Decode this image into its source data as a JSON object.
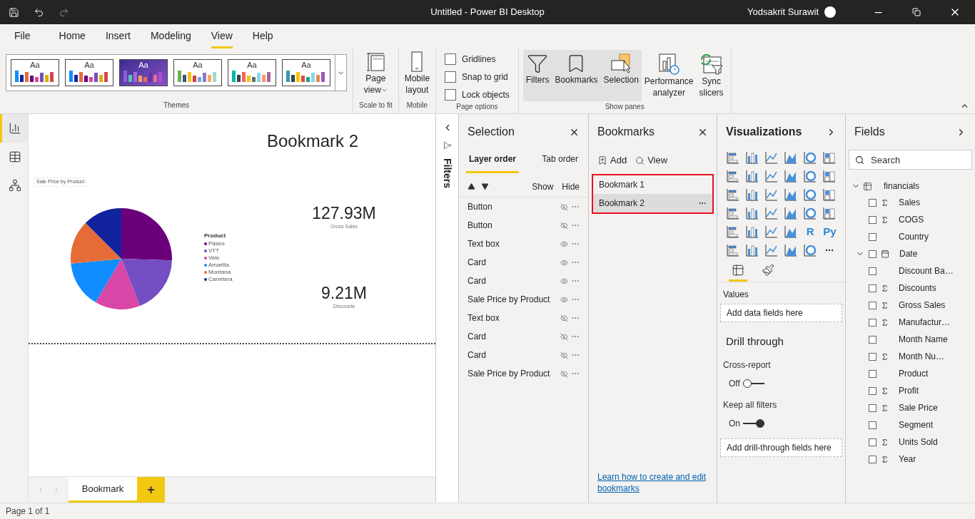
{
  "window": {
    "title": "Untitled - Power BI Desktop",
    "user": "Yodsakrit Surawit"
  },
  "menu_tabs": [
    {
      "label": "File",
      "selected": false
    },
    {
      "label": "Home",
      "selected": false
    },
    {
      "label": "Insert",
      "selected": false
    },
    {
      "label": "Modeling",
      "selected": false
    },
    {
      "label": "View",
      "selected": true
    },
    {
      "label": "Help",
      "selected": false
    }
  ],
  "ribbon": {
    "themes": {
      "items": [
        {
          "label": "Aa",
          "selected": false
        },
        {
          "label": "Aa",
          "selected": false
        },
        {
          "label": "Aa",
          "selected": true
        },
        {
          "label": "Aa",
          "selected": false
        },
        {
          "label": "Aa",
          "selected": false
        },
        {
          "label": "Aa",
          "selected": false
        }
      ],
      "group": "Themes"
    },
    "scale": {
      "label_1": "Page",
      "label_2": "view",
      "group": "Scale to fit"
    },
    "mobile": {
      "label_1": "Mobile",
      "label_2": "layout",
      "group": "Mobile"
    },
    "page_options": {
      "items": [
        {
          "label": "Gridlines",
          "checked": false
        },
        {
          "label": "Snap to grid",
          "checked": false
        },
        {
          "label": "Lock objects",
          "checked": false
        }
      ],
      "group": "Page options"
    },
    "show_panes": {
      "items": [
        {
          "kind": "filters",
          "lines": [
            "Filters"
          ],
          "on": true
        },
        {
          "kind": "bookmarks",
          "lines": [
            "Bookmarks"
          ],
          "on": true
        },
        {
          "kind": "selection",
          "lines": [
            "Selection"
          ],
          "on": true
        },
        {
          "kind": "performance",
          "lines": [
            "Performance",
            "analyzer"
          ],
          "on": false
        },
        {
          "kind": "sync",
          "lines": [
            "Sync",
            "slicers"
          ],
          "on": false
        }
      ],
      "group": "Show panes"
    }
  },
  "left_nav": [
    {
      "kind": "report",
      "selected": true
    },
    {
      "kind": "data",
      "selected": false
    },
    {
      "kind": "model",
      "selected": false
    }
  ],
  "canvas": {
    "title": "Bookmark 2",
    "chart": {
      "title": "Sale Price by Product",
      "legend_title": "Product",
      "legend": [
        {
          "name": "Paseo",
          "color": "#6b007b"
        },
        {
          "name": "VTT",
          "color": "#744ec2"
        },
        {
          "name": "Velo",
          "color": "#d846a8"
        },
        {
          "name": "Amarilla",
          "color": "#118dff"
        },
        {
          "name": "Montana",
          "color": "#e66c37"
        },
        {
          "name": "Carretera",
          "color": "#12239e"
        }
      ]
    },
    "cards": [
      {
        "value": "127.93M",
        "label": "Gross Sales"
      },
      {
        "value": "9.21M",
        "label": "Discounts"
      }
    ],
    "page_tabs": [
      {
        "label": "Bookmark",
        "selected": true
      }
    ],
    "add_page": "+"
  },
  "filters_strip": {
    "label": "Filters"
  },
  "selection": {
    "title": "Selection",
    "tabs": [
      {
        "label": "Layer order",
        "selected": true
      },
      {
        "label": "Tab order",
        "selected": false
      }
    ],
    "show": "Show",
    "hide": "Hide",
    "items": [
      {
        "name": "Button",
        "visible": false
      },
      {
        "name": "Button",
        "visible": false
      },
      {
        "name": "Text box",
        "visible": true
      },
      {
        "name": "Card",
        "visible": true
      },
      {
        "name": "Card",
        "visible": true
      },
      {
        "name": "Sale Price by Product",
        "visible": true
      },
      {
        "name": "Text box",
        "visible": false
      },
      {
        "name": "Card",
        "visible": false
      },
      {
        "name": "Card",
        "visible": false
      },
      {
        "name": "Sale Price by Product",
        "visible": false
      }
    ]
  },
  "bookmarks": {
    "title": "Bookmarks",
    "add": "Add",
    "view": "View",
    "items": [
      {
        "name": "Bookmark 1",
        "selected": false
      },
      {
        "name": "Bookmark 2",
        "selected": true
      }
    ],
    "link": "Learn how to create and edit bookmarks"
  },
  "visualizations": {
    "title": "Visualizations",
    "types": [
      {
        "kind": "chart"
      },
      {
        "kind": "chart"
      },
      {
        "kind": "chart"
      },
      {
        "kind": "chart"
      },
      {
        "kind": "chart"
      },
      {
        "kind": "chart"
      },
      {
        "kind": "chart"
      },
      {
        "kind": "chart"
      },
      {
        "kind": "chart"
      },
      {
        "kind": "chart"
      },
      {
        "kind": "chart"
      },
      {
        "kind": "chart"
      },
      {
        "kind": "chart"
      },
      {
        "kind": "chart"
      },
      {
        "kind": "chart"
      },
      {
        "kind": "chart"
      },
      {
        "kind": "chart"
      },
      {
        "kind": "chart"
      },
      {
        "kind": "chart"
      },
      {
        "kind": "chart"
      },
      {
        "kind": "chart"
      },
      {
        "kind": "chart"
      },
      {
        "kind": "chart"
      },
      {
        "kind": "chart"
      },
      {
        "kind": "chart"
      },
      {
        "kind": "chart"
      },
      {
        "kind": "chart"
      },
      {
        "kind": "chart"
      },
      {
        "kind": "glyph",
        "label": "R"
      },
      {
        "kind": "glyph",
        "label": "Py"
      },
      {
        "kind": "chart"
      },
      {
        "kind": "chart"
      },
      {
        "kind": "chart"
      },
      {
        "kind": "chart"
      },
      {
        "kind": "chart"
      },
      {
        "kind": "more"
      }
    ],
    "tabs": [
      {
        "kind": "fields",
        "selected": true
      },
      {
        "kind": "format",
        "selected": false
      }
    ],
    "values_label": "Values",
    "values_placeholder": "Add data fields here",
    "drill_title": "Drill through",
    "toggles": [
      {
        "label": "Cross-report",
        "on": false,
        "text": "Off"
      },
      {
        "label": "Keep all filters",
        "on": true,
        "text": "On"
      }
    ],
    "drill_placeholder": "Add drill-through fields here"
  },
  "fields": {
    "title": "Fields",
    "search_placeholder": "Search",
    "table": "financials",
    "items": [
      {
        "name": "Sales",
        "kind": "measure",
        "checked": false
      },
      {
        "name": "COGS",
        "kind": "measure",
        "checked": false
      },
      {
        "name": "Country",
        "kind": "text",
        "checked": false
      },
      {
        "name": "Date",
        "kind": "date",
        "checked": false
      },
      {
        "name": "Discount Ba…",
        "kind": "text",
        "checked": false
      },
      {
        "name": "Discounts",
        "kind": "measure",
        "checked": false
      },
      {
        "name": "Gross Sales",
        "kind": "measure",
        "checked": false
      },
      {
        "name": "Manufactur…",
        "kind": "measure",
        "checked": false
      },
      {
        "name": "Month Name",
        "kind": "text",
        "checked": false
      },
      {
        "name": "Month Nu…",
        "kind": "measure",
        "checked": false
      },
      {
        "name": "Product",
        "kind": "text",
        "checked": false
      },
      {
        "name": "Profit",
        "kind": "measure",
        "checked": false
      },
      {
        "name": "Sale Price",
        "kind": "measure",
        "checked": false
      },
      {
        "name": "Segment",
        "kind": "text",
        "checked": false
      },
      {
        "name": "Units Sold",
        "kind": "measure",
        "checked": false
      },
      {
        "name": "Year",
        "kind": "measure",
        "checked": false
      }
    ]
  },
  "status_bar": "Page 1 of 1"
}
